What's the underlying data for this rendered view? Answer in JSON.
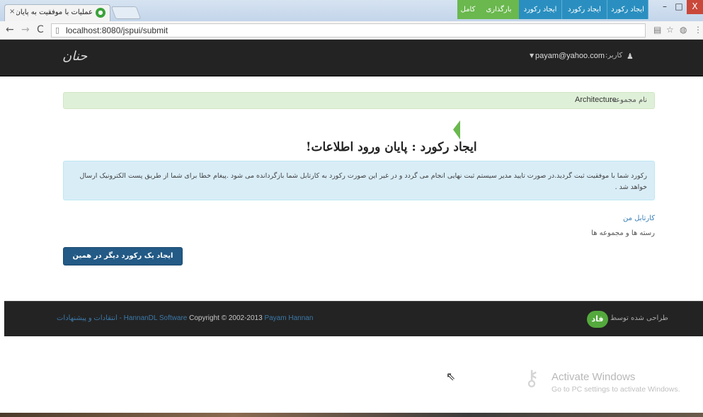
{
  "browser": {
    "tab_title": "عملیات با موفقیت به پایان ر",
    "tab_close": "×",
    "url": "localhost:8080/jspui/submit",
    "window": {
      "minimize": "–",
      "maximize": "□",
      "close": "X"
    }
  },
  "header": {
    "logo": "حنان",
    "user_label": "کاربر:",
    "user_email": "payam@yahoo.com"
  },
  "collection": {
    "label": "نام مجموعه:",
    "value": "Architecture"
  },
  "steps": [
    {
      "label": "ایجاد رکورد"
    },
    {
      "label": "ایجاد رکورد"
    },
    {
      "label": "ایجاد رکورد"
    },
    {
      "label": "بارگذاری"
    },
    {
      "label": "کامل"
    }
  ],
  "main": {
    "title": "ایجاد رکورد : پایان ورود اطلاعات!",
    "info": "رکورد شما با موفقیت ثبت گردید.در صورت تایید مدیر سیستم ثبت نهایی انجام می گردد و در غیر این صورت رکورد به کارتابل شما بازگردانده می شود .پیغام خطا برای شما از طریق پست الکترونیک ارسال خواهد شد .",
    "links": {
      "workspace": "کارتابل من",
      "communities": "رسته ها و مجموعه ها"
    },
    "another_button": "ایجاد یک رکورد دیگر در همین مجموعه"
  },
  "footer": {
    "feedback": "انتقادات و پیشنهادات -",
    "software": "HannanDL Software",
    "copyright": "Copyright © 2002-2013",
    "author": "Payam Hannan",
    "designed_by": "طراحی شده توسط",
    "logo_text": "فاد"
  },
  "watermark": {
    "title": "Activate Windows",
    "subtitle": "Go to PC settings to activate Windows."
  },
  "colors": {
    "header_bg": "#232323",
    "step_blue": "#2a8fc0",
    "step_green": "#6ab84e",
    "collection_bg": "#dff0d8",
    "info_bg": "#d9edf7",
    "button_bg": "#235a86"
  }
}
